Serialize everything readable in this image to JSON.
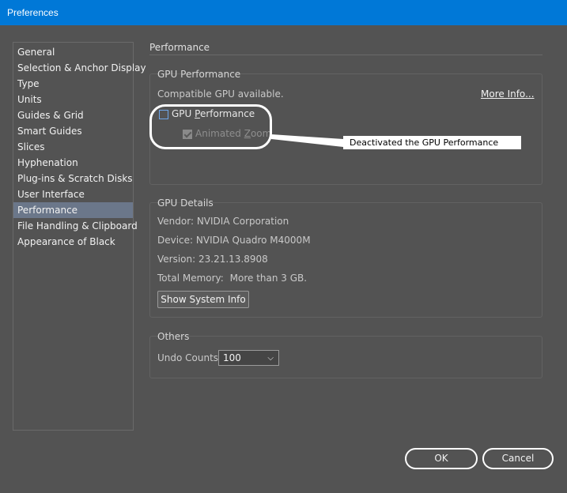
{
  "window": {
    "title": "Preferences"
  },
  "sidebar": {
    "items": [
      {
        "label": "General"
      },
      {
        "label": "Selection & Anchor Display"
      },
      {
        "label": "Type"
      },
      {
        "label": "Units"
      },
      {
        "label": "Guides & Grid"
      },
      {
        "label": "Smart Guides"
      },
      {
        "label": "Slices"
      },
      {
        "label": "Hyphenation"
      },
      {
        "label": "Plug-ins & Scratch Disks"
      },
      {
        "label": "User Interface"
      },
      {
        "label": "Performance"
      },
      {
        "label": "File Handling & Clipboard"
      },
      {
        "label": "Appearance of Black"
      }
    ],
    "selected": "Performance"
  },
  "main": {
    "section_title": "Performance",
    "gpu_performance": {
      "group_label": "GPU Performance",
      "compatible_text": "Compatible GPU available.",
      "more_info_link": "More Info...",
      "gpu_checkbox_label_pre": "GPU ",
      "gpu_checkbox_label_accel": "P",
      "gpu_checkbox_label_post": "erformance",
      "gpu_checked": false,
      "animated_zoom_label_pre": "Animated ",
      "animated_zoom_label_accel": "Z",
      "animated_zoom_label_post": "oom",
      "animated_zoom_checked": true,
      "animated_zoom_enabled": false
    },
    "gpu_details": {
      "group_label": "GPU Details",
      "vendor_label": "Vendor:",
      "vendor_value": "NVIDIA Corporation",
      "device_label": "Device:",
      "device_value": "NVIDIA Quadro M4000M",
      "version_label": "Version:",
      "version_value": "23.21.13.8908",
      "memory_label": "Total Memory:",
      "memory_value": "More than 3 GB.",
      "system_info_button": "Show System Info"
    },
    "others": {
      "group_label": "Others",
      "undo_label": "Undo Counts:",
      "undo_value": "100"
    }
  },
  "annotation": {
    "text": "Deactivated the GPU Performance"
  },
  "footer": {
    "ok_label": "OK",
    "cancel_label": "Cancel"
  },
  "colors": {
    "titlebar": "#0078d7",
    "background": "#535353",
    "selected": "#6b778a"
  }
}
